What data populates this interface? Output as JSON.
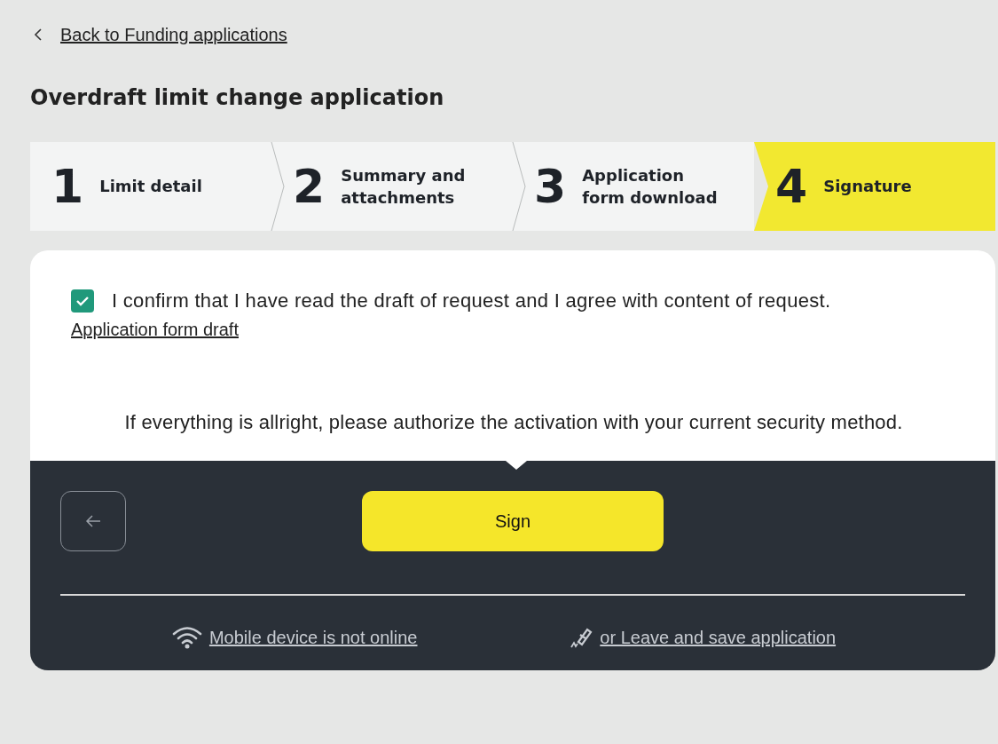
{
  "back_link": "Back to Funding applications",
  "title": "Overdraft limit change application",
  "steps": [
    {
      "number": "1",
      "label": "Limit detail",
      "selected": false
    },
    {
      "number": "2",
      "label": "Summary and attachments",
      "selected": false
    },
    {
      "number": "3",
      "label": "Application form download",
      "selected": false
    },
    {
      "number": "4",
      "label": "Signature",
      "selected": true
    }
  ],
  "confirm": {
    "checked": true,
    "label": "I confirm that I have read the draft of request and I agree with content of request."
  },
  "draft_link": "Application form draft",
  "instruction": "If everything is allright, please authorize the activation with your current security method.",
  "sign_button": "Sign",
  "footer_links": [
    {
      "kind": "wifi",
      "label": "Mobile device is not online"
    },
    {
      "kind": "pen",
      "label": "or Leave and save application"
    }
  ]
}
